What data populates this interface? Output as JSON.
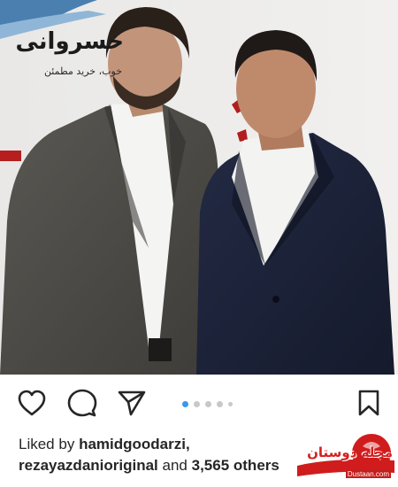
{
  "photo": {
    "banner_title": "خسروانی",
    "banner_subtitle": "خوب، خرید مطمئن",
    "alt": "photo"
  },
  "actions": {
    "like_icon": "heart-icon",
    "comment_icon": "comment-icon",
    "share_icon": "paper-plane-icon",
    "save_icon": "bookmark-icon",
    "carousel": {
      "total": 5,
      "current": 1
    },
    "accent": "#3897f0"
  },
  "likes": {
    "prefix": "Liked by",
    "user1": "hamidgoodarzi,",
    "user2": "rezayazdanioriginal",
    "connector": "and",
    "count": "3,565 others"
  },
  "watermark": {
    "title": "مجله دوستان",
    "url": "Dustaan.com"
  }
}
